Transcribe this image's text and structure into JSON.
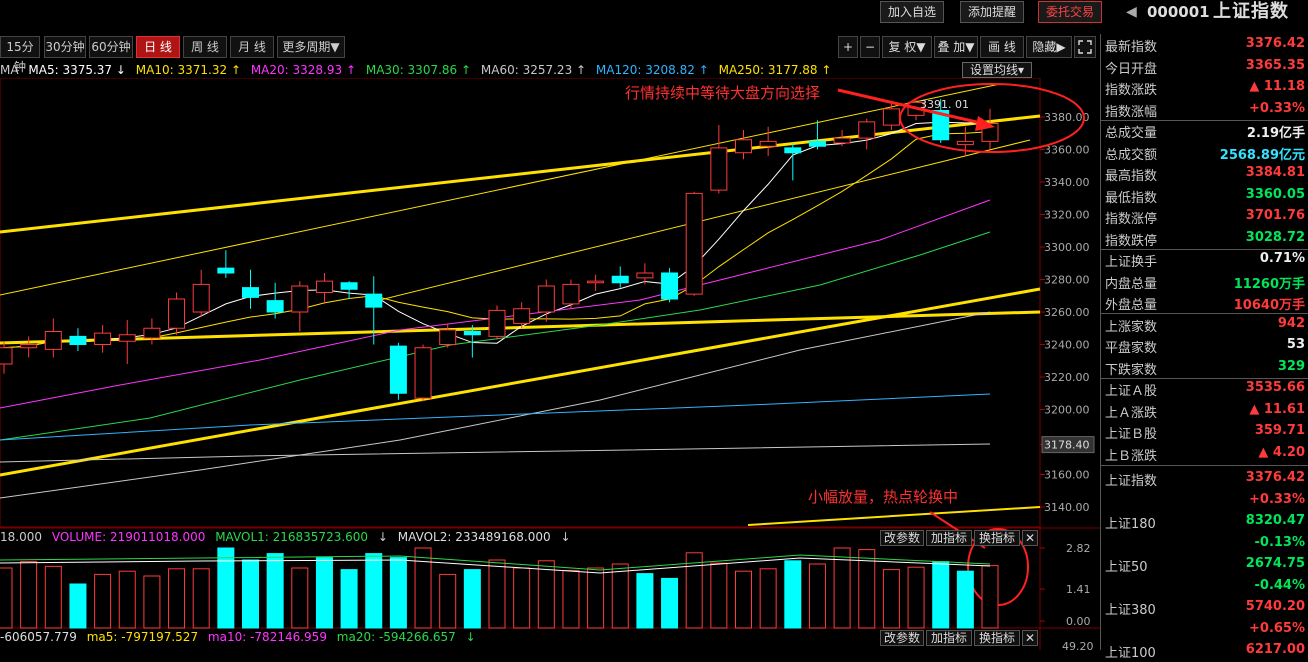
{
  "topbar": {
    "add_watch": "加入自选",
    "add_alert": "添加提醒",
    "order": "委托交易",
    "code": "000001",
    "name": "上证指数",
    "back_icon": "◀"
  },
  "period": {
    "items": [
      "15分钟",
      "30分钟",
      "60分钟",
      "日 线",
      "周 线",
      "月 线",
      "更多周期▼"
    ],
    "active": 3
  },
  "tools": {
    "plus": "+",
    "minus": "−",
    "fq": "复 权",
    "fq_arrow": "▼",
    "overlay": "叠 加",
    "overlay_arrow": "▼",
    "draw": "画 线",
    "hide": "隐藏",
    "hide_arrow": "▶"
  },
  "ma_legend": {
    "prefix": "MA",
    "items": [
      {
        "text": "MA5: 3375.37",
        "arrow": "↓",
        "color": "#ffffff"
      },
      {
        "text": "MA10: 3371.32",
        "arrow": "↑",
        "color": "#ffe100"
      },
      {
        "text": "MA20: 3328.93",
        "arrow": "↑",
        "color": "#ff35ff"
      },
      {
        "text": "MA30: 3307.86",
        "arrow": "↑",
        "color": "#2bd84a"
      },
      {
        "text": "MA60: 3257.23",
        "arrow": "↑",
        "color": "#c8c8c8"
      },
      {
        "text": "MA120: 3208.82",
        "arrow": "↑",
        "color": "#2fb4ff"
      },
      {
        "text": "MA250: 3177.88",
        "arrow": "↑",
        "color": "#ffe100"
      }
    ],
    "set_label": "设置均线"
  },
  "price_axis": {
    "ticks": [
      "3380.00",
      "3360.00",
      "3340.00",
      "3320.00",
      "3300.00",
      "3280.00",
      "3260.00",
      "3240.00",
      "3220.00",
      "3200.00",
      "3178.40",
      "3160.00",
      "3140.00"
    ]
  },
  "annotations": {
    "top": "行情持续中等待大盘方向选择",
    "bottom": "小幅放量，热点轮换中",
    "high_label": "3391. 01"
  },
  "vol_legend": {
    "prefix": "18.000",
    "volume": "VOLUME: 219011018.000",
    "mavol1": "MAVOL1: 216835723.600",
    "mavol2": "MAVOL2: 233489168.000",
    "arrow": "↓"
  },
  "vol_axis": {
    "ticks": [
      "2.82",
      "1.41",
      "0.00"
    ]
  },
  "macd_legend": {
    "prefix": "-606057.779",
    "ma5": "ma5: -797197.527",
    "ma10": "ma10: -782146.959",
    "ma20": "ma20: -594266.657",
    "arrow": "↓"
  },
  "macd_axis": {
    "tick": "49.20"
  },
  "ind_buttons": {
    "param": "改参数",
    "add": "加指标",
    "swap": "换指标",
    "close": "✕"
  },
  "quote_rows": [
    {
      "label": "最新指数",
      "value": "3376.42",
      "cls": "red"
    },
    {
      "label": "今日开盘",
      "value": "3365.35",
      "cls": "red"
    },
    {
      "label": "指数涨跌",
      "value": "▲ 11.18",
      "cls": "red"
    },
    {
      "label": "指数涨幅",
      "value": "+0.33%",
      "cls": "red"
    },
    {
      "label": "总成交量",
      "value": "2.19亿手",
      "cls": "white"
    },
    {
      "label": "总成交额",
      "value": "2568.89亿元",
      "cls": "cyan"
    },
    {
      "label": "最高指数",
      "value": "3384.81",
      "cls": "red"
    },
    {
      "label": "最低指数",
      "value": "3360.05",
      "cls": "green"
    },
    {
      "label": "指数涨停",
      "value": "3701.76",
      "cls": "red"
    },
    {
      "label": "指数跌停",
      "value": "3028.72",
      "cls": "green"
    },
    {
      "label": "上证换手",
      "value": "0.71%",
      "cls": "white"
    },
    {
      "label": "内盘总量",
      "value": "11260万手",
      "cls": "green"
    },
    {
      "label": "外盘总量",
      "value": "10640万手",
      "cls": "red"
    },
    {
      "label": "上涨家数",
      "value": "942",
      "cls": "red"
    },
    {
      "label": "平盘家数",
      "value": "53",
      "cls": "white"
    },
    {
      "label": "下跌家数",
      "value": "329",
      "cls": "green"
    },
    {
      "label": "上证Ａ股",
      "value": "3535.66",
      "cls": "red"
    },
    {
      "label": "上Ａ涨跌",
      "value": "▲ 11.61",
      "cls": "red"
    },
    {
      "label": "上证Ｂ股",
      "value": "359.71",
      "cls": "red"
    },
    {
      "label": "上Ｂ涨跌",
      "value": "▲ 4.20",
      "cls": "red"
    }
  ],
  "index_rows": [
    {
      "label": "上证指数",
      "value": "3376.42",
      "change": "+0.33%",
      "cls": "red"
    },
    {
      "label": "上证180",
      "value": "8320.47",
      "change": "-0.13%",
      "cls": "green"
    },
    {
      "label": "上证50",
      "value": "2674.75",
      "change": "-0.44%",
      "cls": "green"
    },
    {
      "label": "上证380",
      "value": "5740.20",
      "change": "+0.65%",
      "cls": "red"
    },
    {
      "label": "上证100",
      "value": "6217.00",
      "change": "",
      "cls": "red"
    }
  ],
  "chart_data": {
    "type": "candlestick",
    "y_range": [
      3130,
      3395
    ],
    "candles": [
      {
        "o": 3228,
        "c": 3238,
        "h": 3242,
        "l": 3222
      },
      {
        "o": 3238,
        "c": 3240,
        "h": 3245,
        "l": 3232
      },
      {
        "o": 3237,
        "c": 3248,
        "h": 3256,
        "l": 3232
      },
      {
        "o": 3245,
        "c": 3240,
        "h": 3250,
        "l": 3236
      },
      {
        "o": 3240,
        "c": 3247,
        "h": 3252,
        "l": 3235
      },
      {
        "o": 3242,
        "c": 3246,
        "h": 3255,
        "l": 3228
      },
      {
        "o": 3244,
        "c": 3250,
        "h": 3256,
        "l": 3240
      },
      {
        "o": 3250,
        "c": 3268,
        "h": 3272,
        "l": 3246
      },
      {
        "o": 3260,
        "c": 3277,
        "h": 3286,
        "l": 3257
      },
      {
        "o": 3287,
        "c": 3284,
        "h": 3298,
        "l": 3281
      },
      {
        "o": 3275,
        "c": 3269,
        "h": 3286,
        "l": 3262
      },
      {
        "o": 3267,
        "c": 3260,
        "h": 3278,
        "l": 3256
      },
      {
        "o": 3260,
        "c": 3276,
        "h": 3279,
        "l": 3248
      },
      {
        "o": 3272,
        "c": 3279,
        "h": 3284,
        "l": 3265
      },
      {
        "o": 3278,
        "c": 3274,
        "h": 3279,
        "l": 3268
      },
      {
        "o": 3271,
        "c": 3263,
        "h": 3282,
        "l": 3240
      },
      {
        "o": 3239,
        "c": 3210,
        "h": 3241,
        "l": 3206
      },
      {
        "o": 3207,
        "c": 3238,
        "h": 3240,
        "l": 3205
      },
      {
        "o": 3240,
        "c": 3249,
        "h": 3253,
        "l": 3238
      },
      {
        "o": 3248,
        "c": 3246,
        "h": 3252,
        "l": 3232
      },
      {
        "o": 3245,
        "c": 3261,
        "h": 3264,
        "l": 3243
      },
      {
        "o": 3253,
        "c": 3262,
        "h": 3266,
        "l": 3250
      },
      {
        "o": 3260,
        "c": 3276,
        "h": 3280,
        "l": 3254
      },
      {
        "o": 3265,
        "c": 3277,
        "h": 3280,
        "l": 3262
      },
      {
        "o": 3278,
        "c": 3279,
        "h": 3283,
        "l": 3273
      },
      {
        "o": 3282,
        "c": 3278,
        "h": 3288,
        "l": 3275
      },
      {
        "o": 3281,
        "c": 3284,
        "h": 3290,
        "l": 3277
      },
      {
        "o": 3284,
        "c": 3268,
        "h": 3287,
        "l": 3266
      },
      {
        "o": 3271,
        "c": 3333,
        "h": 3334,
        "l": 3270
      },
      {
        "o": 3335,
        "c": 3361,
        "h": 3375,
        "l": 3333
      },
      {
        "o": 3358,
        "c": 3366,
        "h": 3372,
        "l": 3354
      },
      {
        "o": 3362,
        "c": 3365,
        "h": 3374,
        "l": 3356
      },
      {
        "o": 3361,
        "c": 3358,
        "h": 3364,
        "l": 3341
      },
      {
        "o": 3365,
        "c": 3362,
        "h": 3378,
        "l": 3360
      },
      {
        "o": 3364,
        "c": 3367,
        "h": 3372,
        "l": 3362
      },
      {
        "o": 3367,
        "c": 3377,
        "h": 3379,
        "l": 3360
      },
      {
        "o": 3375,
        "c": 3385,
        "h": 3388,
        "l": 3372
      },
      {
        "o": 3381,
        "c": 3389,
        "h": 3391,
        "l": 3378
      },
      {
        "o": 3384,
        "c": 3366,
        "h": 3391,
        "l": 3364
      },
      {
        "o": 3363,
        "c": 3365,
        "h": 3374,
        "l": 3356
      },
      {
        "o": 3365,
        "c": 3376,
        "h": 3385,
        "l": 3360
      }
    ],
    "volume_ratio": [
      0.75,
      0.83,
      0.77,
      0.55,
      0.67,
      0.71,
      0.65,
      0.74,
      0.74,
      1.0,
      0.85,
      0.93,
      0.75,
      0.88,
      0.73,
      0.93,
      0.88,
      1.0,
      0.67,
      0.73,
      0.85,
      0.75,
      0.84,
      0.72,
      0.75,
      0.8,
      0.68,
      0.62,
      0.94,
      0.81,
      0.71,
      0.74,
      0.84,
      0.8,
      1.0,
      0.98,
      0.73,
      0.76,
      0.83,
      0.71,
      0.78
    ],
    "volume_up": [
      true,
      true,
      true,
      false,
      true,
      true,
      true,
      true,
      true,
      false,
      false,
      false,
      true,
      false,
      false,
      false,
      false,
      true,
      true,
      false,
      true,
      true,
      true,
      true,
      true,
      true,
      false,
      false,
      true,
      true,
      true,
      true,
      false,
      true,
      true,
      true,
      true,
      true,
      false,
      false,
      true
    ]
  }
}
